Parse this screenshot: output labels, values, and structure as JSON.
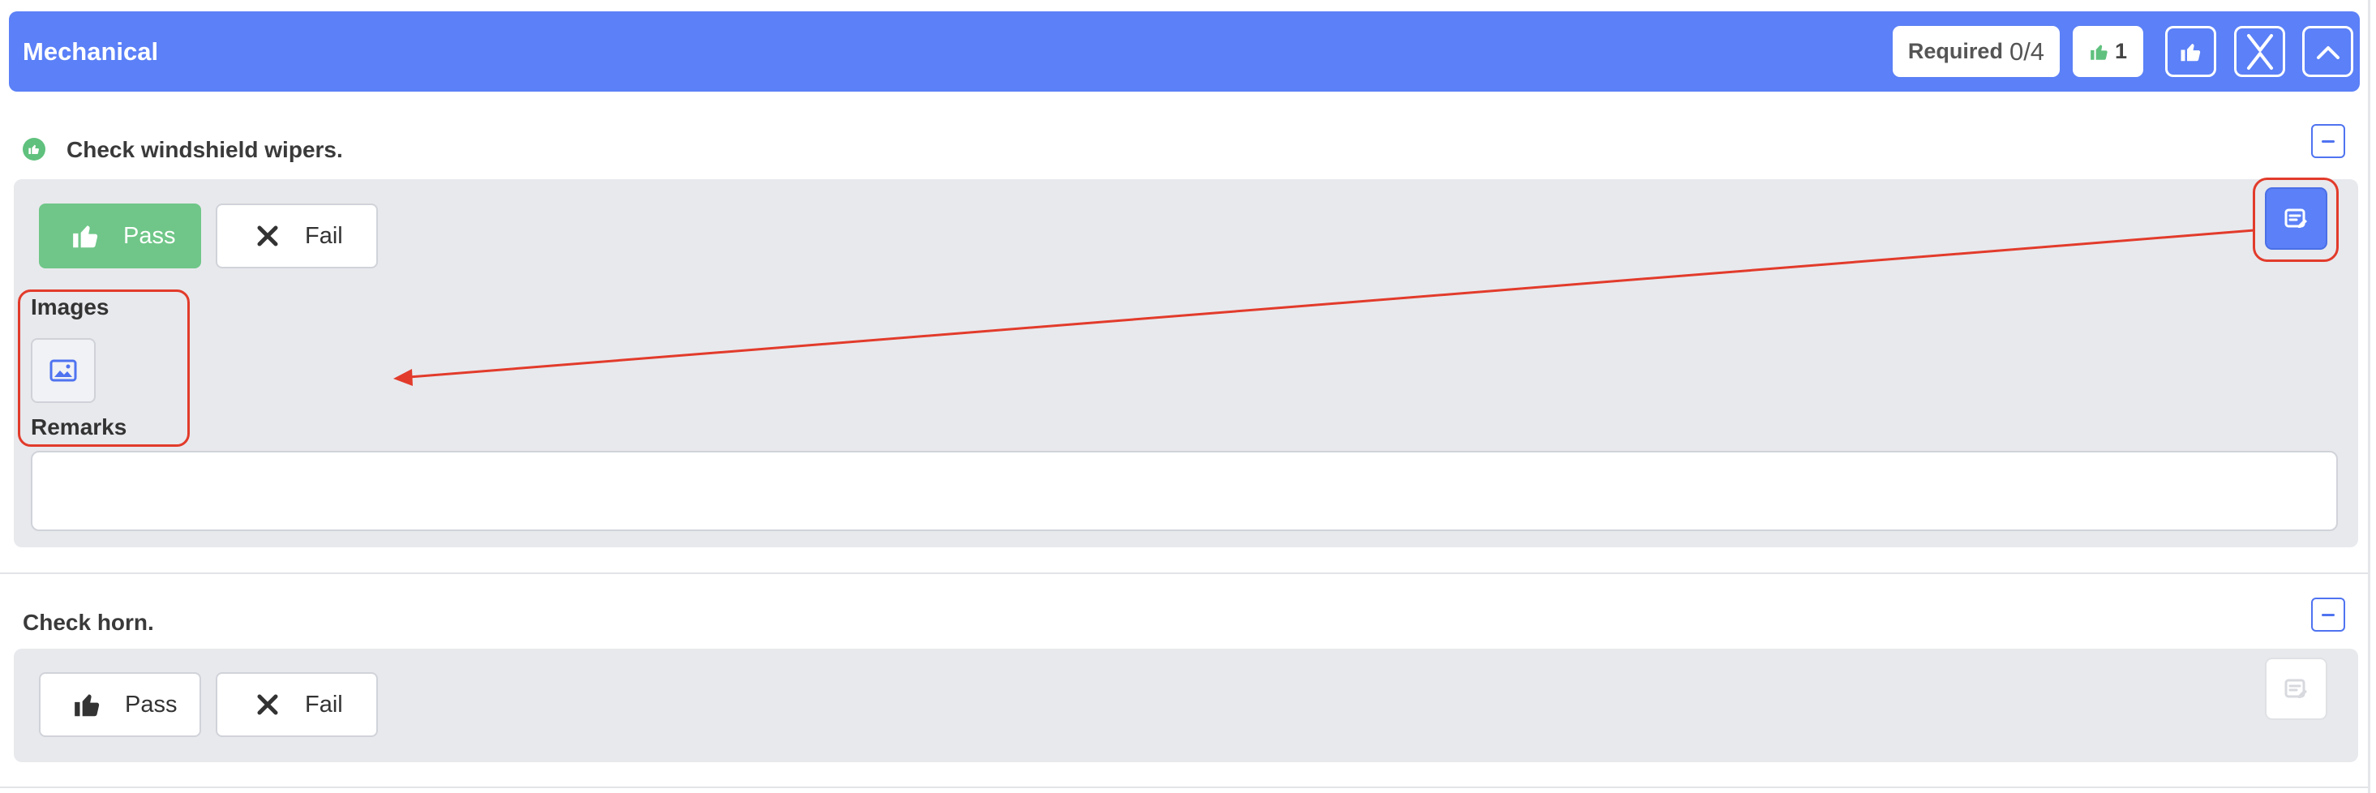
{
  "section": {
    "title": "Mechanical",
    "required_label": "Required",
    "required_value": "0/4",
    "pass_count": "1"
  },
  "items": [
    {
      "title": "Check windshield wipers.",
      "pass_label": "Pass",
      "fail_label": "Fail",
      "status": "pass",
      "images_label": "Images",
      "remarks_label": "Remarks",
      "remarks_value": ""
    },
    {
      "title": "Check horn.",
      "pass_label": "Pass",
      "fail_label": "Fail",
      "status": "none"
    }
  ],
  "colors": {
    "header": "#5b80f7",
    "pass": "#6fc688",
    "annotation": "#e23b2b"
  },
  "icons": [
    "thumbs-up-icon",
    "close-icon",
    "collapse-all-icon",
    "chevron-up-icon",
    "note-edit-icon",
    "image-icon",
    "minus-icon"
  ]
}
